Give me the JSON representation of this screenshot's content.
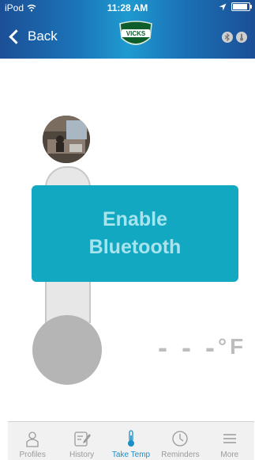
{
  "status_bar": {
    "carrier": "iPod",
    "time": "11:28 AM"
  },
  "navbar": {
    "back_label": "Back",
    "logo_text": "VICKS"
  },
  "overlay": {
    "line1": "Enable",
    "line2": "Bluetooth"
  },
  "temperature": {
    "value": "- - -",
    "unit": "°F"
  },
  "tabs": [
    {
      "label": "Profiles",
      "icon": "profile-icon"
    },
    {
      "label": "History",
      "icon": "history-icon"
    },
    {
      "label": "Take Temp",
      "icon": "thermometer-icon",
      "active": true
    },
    {
      "label": "Reminders",
      "icon": "clock-icon"
    },
    {
      "label": "More",
      "icon": "menu-icon"
    }
  ],
  "colors": {
    "accent": "#1a8fc7",
    "overlay": "#13a8c1",
    "overlay_text": "#a7e4ee",
    "navbar": "#1b74b8"
  }
}
